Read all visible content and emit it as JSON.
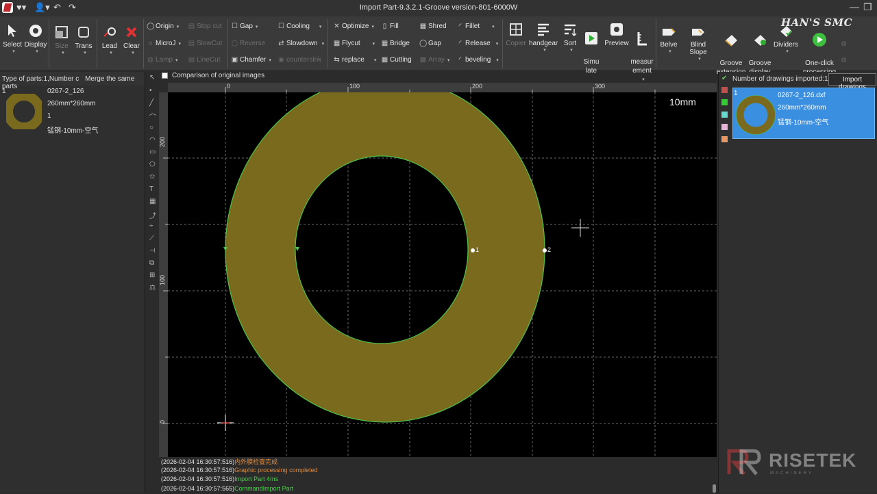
{
  "titlebar": {
    "title": "Import Part-9.3.2.1-Groove version-801-6000W"
  },
  "watermark": "HAN'S SMC",
  "ribbon": {
    "select": "Select",
    "display": "Display",
    "size": "Size",
    "trans": "Trans",
    "lead": "Lead",
    "clear": "Clear",
    "origin": "Origin",
    "stop_cut": "Stop cut",
    "microj": "MicroJ",
    "slowcut": "SlowCut",
    "lamp": "Lamp",
    "linecut": "LineCut",
    "gap1": "Gap",
    "reverse": "Reverse",
    "chamfer": "Chamfer",
    "countersink": "countersink",
    "cooling": "Cooling",
    "slowdown": "Slowdown",
    "optimize": "Optimize",
    "flycut": "Flycut",
    "replace": "replace",
    "fill": "Fill",
    "bridge": "Bridge",
    "cutting": "Cutting",
    "shred": "Shred",
    "gap2": "Gap",
    "array": "Array",
    "fillet": "Fillet",
    "release": "Release",
    "beveling": "beveling",
    "copier": "Copier",
    "handgear": "handgear",
    "sort": "Sort",
    "simulate": "Simu\nlate",
    "preview": "Preview",
    "measurement": "measur\nement",
    "belve": "Belve",
    "blind_slope": "Blind Slope",
    "groove_extension": "Groove\nextension",
    "groove_display": "Groove\ndisplay",
    "dividers": "Dividers",
    "one_click": "One-click\nprocessing"
  },
  "left_panel": {
    "type_of_parts": "Type of parts:1,Number c",
    "merge": "Merge the same parts",
    "item": {
      "index": "1",
      "name": "0267-2_126",
      "size": "260mm*260mm",
      "count": "1",
      "material": "锰钢-10mm-空气"
    }
  },
  "canvas": {
    "comparison_label": "Comparison of original images",
    "thickness": "10mm",
    "h_ticks": [
      "0",
      "100",
      "200",
      "300"
    ],
    "v_ticks": [
      "200",
      "100",
      "0"
    ],
    "point_labels": [
      "1",
      "2"
    ]
  },
  "log": [
    {
      "time": "(2026-02-04 16:30:57:516)",
      "msg": "内外膜检查完成",
      "color": "#e08a3c"
    },
    {
      "time": "(2026-02-04 16:30:57:516)",
      "msg": "Graphic processing completed",
      "color": "#e08a3c"
    },
    {
      "time": "(2026-02-04 16:30:57:516)",
      "msg": "Import Part 4ms",
      "color": "#4cd44c"
    },
    {
      "time": "(2026-02-04 16:30:57:565)",
      "msg": "CommandImport Part",
      "color": "#4cd44c"
    }
  ],
  "right_panel": {
    "header": "Number of drawings imported:1",
    "import_button": "Import drawings",
    "item": {
      "index": "1",
      "file": "0267-2_126.dxf",
      "size": "260mm*260mm",
      "material": "锰钢-10mm-空气"
    },
    "swatch_colors": [
      "#c0504d",
      "#33cc33",
      "#66d9cc",
      "#e6b3d9",
      "#e69966"
    ]
  },
  "brand": {
    "name": "RISETEK",
    "sub": "MACHINERY"
  },
  "colors": {
    "part_fill": "#7a6a1e",
    "part_outline": "#4cc24c"
  }
}
